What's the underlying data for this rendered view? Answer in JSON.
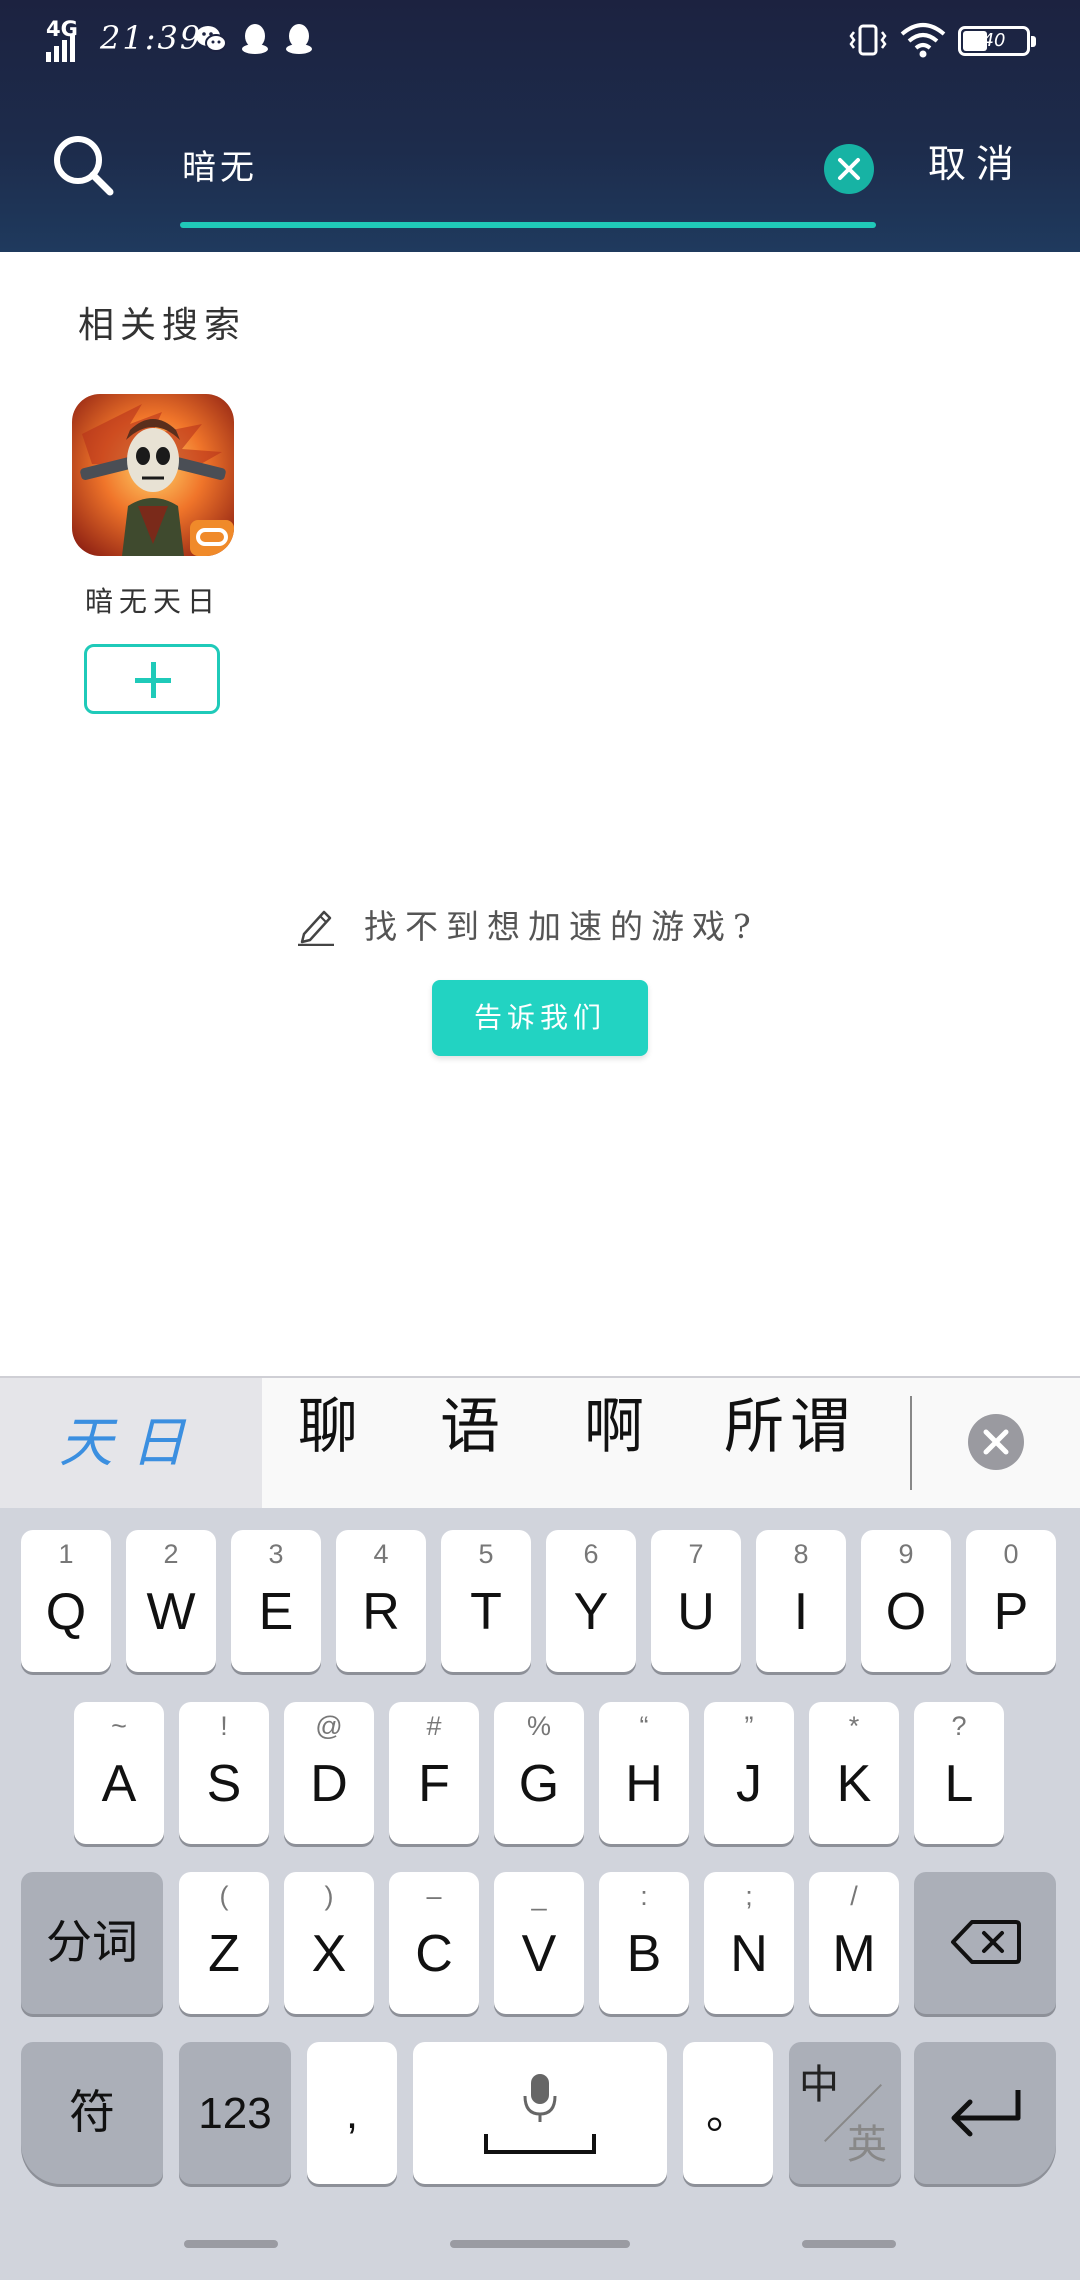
{
  "status_bar": {
    "network": "4G",
    "time": "21:39",
    "battery": "40"
  },
  "search": {
    "query": "暗无",
    "cancel_label": "取消"
  },
  "results": {
    "section_title": "相关搜索",
    "items": [
      {
        "name": "暗无天日"
      }
    ]
  },
  "feedback": {
    "prompt": "找不到想加速的游戏?",
    "button_label": "告诉我们"
  },
  "ime": {
    "composing": "天日",
    "candidates": [
      "聊",
      "语",
      "啊",
      "所谓"
    ]
  },
  "keyboard": {
    "row1": [
      {
        "key": "Q",
        "sub": "1"
      },
      {
        "key": "W",
        "sub": "2"
      },
      {
        "key": "E",
        "sub": "3"
      },
      {
        "key": "R",
        "sub": "4"
      },
      {
        "key": "T",
        "sub": "5"
      },
      {
        "key": "Y",
        "sub": "6"
      },
      {
        "key": "U",
        "sub": "7"
      },
      {
        "key": "I",
        "sub": "8"
      },
      {
        "key": "O",
        "sub": "9"
      },
      {
        "key": "P",
        "sub": "0"
      }
    ],
    "row2": [
      {
        "key": "A",
        "sub": "~"
      },
      {
        "key": "S",
        "sub": "!"
      },
      {
        "key": "D",
        "sub": "@"
      },
      {
        "key": "F",
        "sub": "#"
      },
      {
        "key": "G",
        "sub": "%"
      },
      {
        "key": "H",
        "sub": "“"
      },
      {
        "key": "J",
        "sub": "”"
      },
      {
        "key": "K",
        "sub": "*"
      },
      {
        "key": "L",
        "sub": "?"
      }
    ],
    "row3": [
      {
        "key": "Z",
        "sub": "("
      },
      {
        "key": "X",
        "sub": ")"
      },
      {
        "key": "C",
        "sub": "–"
      },
      {
        "key": "V",
        "sub": "_"
      },
      {
        "key": "B",
        "sub": ":"
      },
      {
        "key": "N",
        "sub": ";"
      },
      {
        "key": "M",
        "sub": "/"
      }
    ],
    "segment_label": "分词",
    "symbol_label": "符",
    "numeric_label": "123",
    "comma_label": ",",
    "period_label": "。",
    "lang_primary": "中",
    "lang_secondary": "英"
  }
}
